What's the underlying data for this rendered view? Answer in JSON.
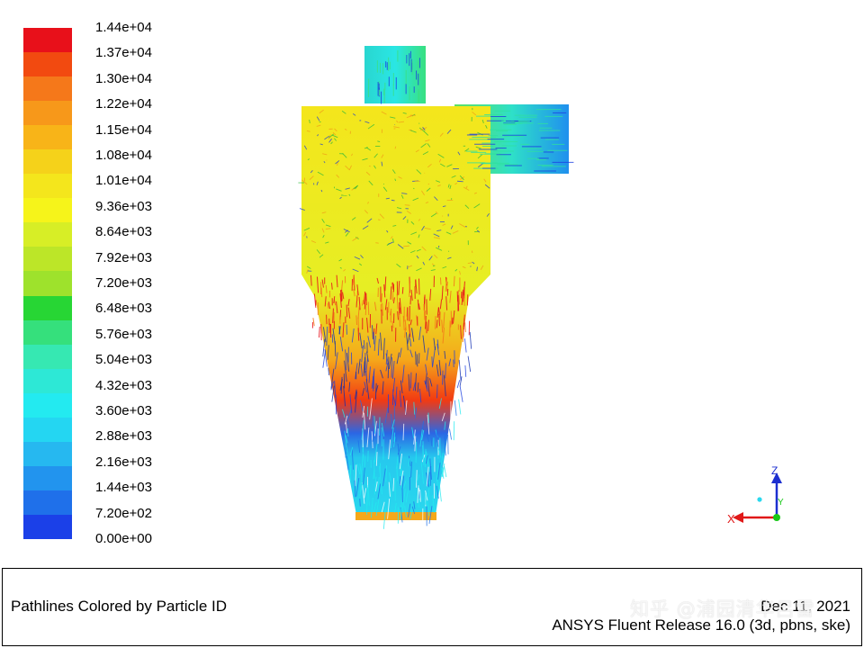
{
  "colorbar": {
    "colors": [
      "#e8101a",
      "#f24a10",
      "#f5781a",
      "#f7981a",
      "#f8b418",
      "#f5d21a",
      "#f4e61c",
      "#f6f41a",
      "#d7ee26",
      "#bce628",
      "#9ee22c",
      "#27d634",
      "#35e07c",
      "#36e8b2",
      "#2de8d6",
      "#23eaf0",
      "#24d6f2",
      "#26b8f0",
      "#2294ee",
      "#1f70ea",
      "#1b40e8"
    ],
    "labels": [
      "1.44e+04",
      "1.37e+04",
      "1.30e+04",
      "1.22e+04",
      "1.15e+04",
      "1.08e+04",
      "1.01e+04",
      "9.36e+03",
      "8.64e+03",
      "7.92e+03",
      "7.20e+03",
      "6.48e+03",
      "5.76e+03",
      "5.04e+03",
      "4.32e+03",
      "3.60e+03",
      "2.88e+03",
      "2.16e+03",
      "1.44e+03",
      "7.20e+02",
      "0.00e+00"
    ]
  },
  "axis_triad": {
    "x_label": "X",
    "z_label": "Z",
    "y_label": "Y"
  },
  "footer": {
    "title": "Pathlines Colored by Particle ID",
    "date": "Dec 11, 2021",
    "release": "ANSYS Fluent Release 16.0 (3d, pbns, ske)"
  },
  "watermark": "知乎 @浦园清华吕雷"
}
